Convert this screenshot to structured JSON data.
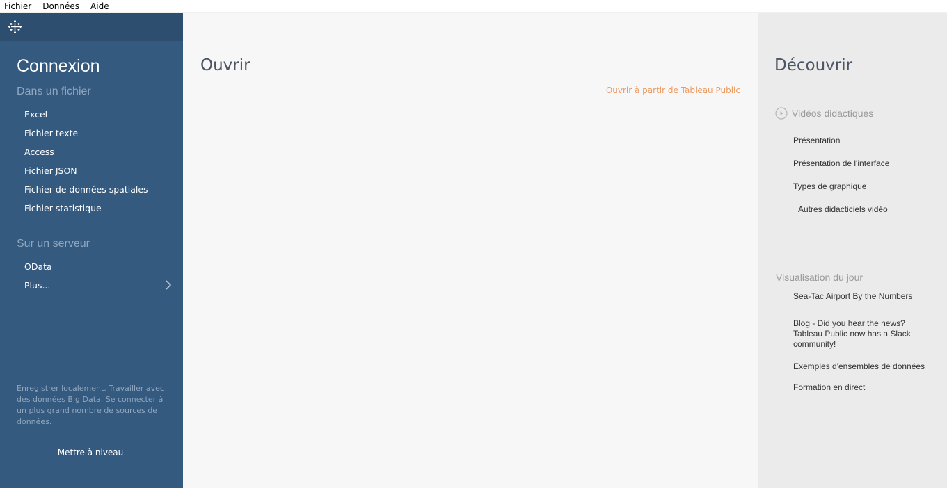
{
  "menubar": {
    "items": [
      "Fichier",
      "Données",
      "Aide"
    ]
  },
  "left_panel": {
    "logo_icon": "tableau-logo-icon",
    "title": "Connexion",
    "file_section": {
      "header": "Dans un fichier",
      "items": [
        "Excel",
        "Fichier texte",
        "Access",
        "Fichier JSON",
        "Fichier de données spatiales",
        "Fichier statistique"
      ]
    },
    "server_section": {
      "header": "Sur un serveur",
      "items": [
        "OData",
        "Plus..."
      ],
      "more_icon": "chevron-right-icon"
    },
    "promo_text": "Enregistrer localement. Travailler avec des données Big Data. Se connecter à un plus grand nombre de sources de données.",
    "upgrade_button": "Mettre à niveau",
    "colors": {
      "background": "#355a80",
      "topbar": "#2d4e6e"
    }
  },
  "middle_panel": {
    "title": "Ouvrir",
    "public_link": "Ouvrir à partir de Tableau Public",
    "colors": {
      "background": "#f7f7f7",
      "link": "#eb9a62"
    }
  },
  "right_panel": {
    "title": "Découvrir",
    "videos": {
      "header": "Vidéos didactiques",
      "icon": "play-circle-icon",
      "items": [
        "Présentation",
        "Présentation de l'interface",
        "Types de graphique",
        "Autres didacticiels vidéo"
      ]
    },
    "viz_of_day": {
      "header": "Visualisation du jour",
      "items": [
        "Sea-Tac Airport By the Numbers",
        "Blog - Did you hear the news? Tableau Public now has a Slack community!",
        "Exemples d'ensembles de données",
        "Formation en direct"
      ]
    },
    "colors": {
      "background": "#ebebeb"
    }
  }
}
